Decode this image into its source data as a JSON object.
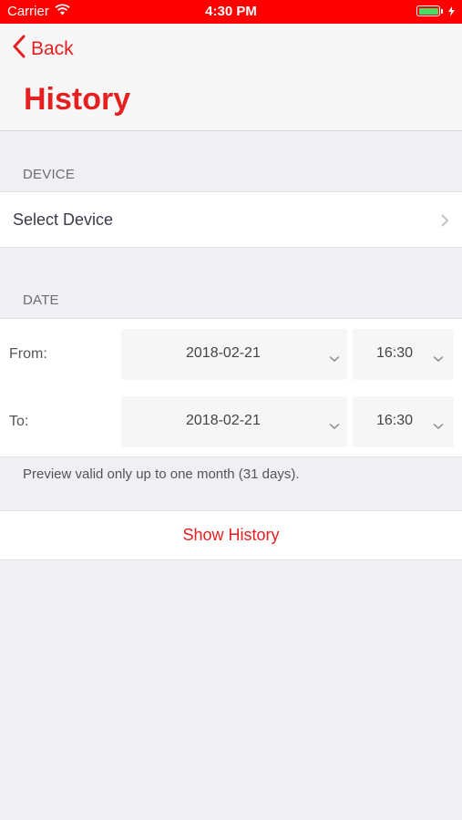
{
  "status_bar": {
    "carrier": "Carrier",
    "time": "4:30 PM"
  },
  "nav": {
    "back_label": "Back",
    "title": "History"
  },
  "device_section": {
    "header": "DEVICE",
    "select_label": "Select Device"
  },
  "date_section": {
    "header": "DATE",
    "from_label": "From:",
    "from_date": "2018-02-21",
    "from_time": "16:30",
    "to_label": "To:",
    "to_date": "2018-02-21",
    "to_time": "16:30",
    "note": "Preview valid only up to one month (31 days)."
  },
  "actions": {
    "show_history": "Show History"
  },
  "colors": {
    "accent": "#e62020",
    "status_bar": "#ff0000",
    "battery": "#4cd964",
    "background": "#efeff4"
  },
  "icons": {
    "back": "chevron-left-icon",
    "device_disclosure": "chevron-right-icon",
    "dropdown": "chevron-down-icon",
    "wifi": "wifi-icon",
    "battery": "battery-icon"
  }
}
